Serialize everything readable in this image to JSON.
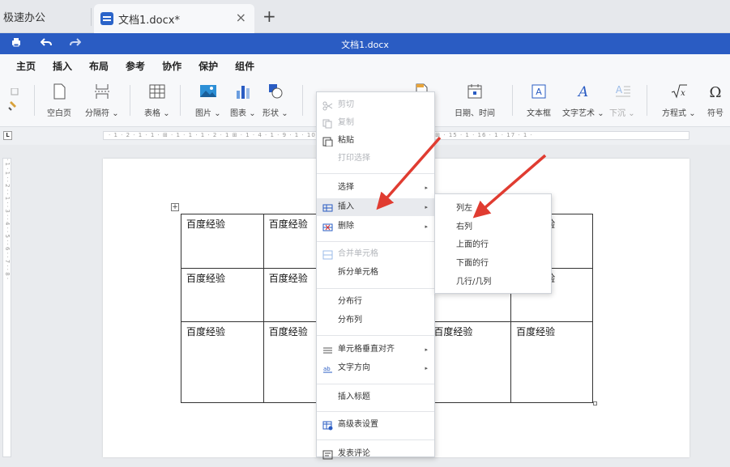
{
  "tabs": {
    "app_label": "极速办公",
    "doc_tab_label": "文档1.docx*",
    "close": "×",
    "new": "+"
  },
  "titlebar": {
    "doc_title": "文档1.docx",
    "icons": [
      "print-icon",
      "undo-icon",
      "redo-icon"
    ]
  },
  "menu_tabs": [
    "主页",
    "插入",
    "布局",
    "参考",
    "协作",
    "保护",
    "组件"
  ],
  "active_menu_tab": "插入",
  "ribbon": {
    "blank_page": "空白页",
    "page_break": "分隔符",
    "table": "表格",
    "picture": "图片",
    "chart": "图表",
    "shape": "形状",
    "header_footer_partial": "脚",
    "datetime": "日期、时间",
    "textbox": "文本框",
    "textart": "文字艺术",
    "dropcap": "下沉",
    "equation": "方程式",
    "symbol": "符号",
    "dropdown_mark": "⌄"
  },
  "ruler": {
    "marks": "· 1 · 2 · 1 · 1 · ⊞ · 1 · 1 · 1 · 2 · 1 ⊞ · 1 · 4 · 1 ·                                     9 · 1 · 10 · 1 · 11 · ⊞ 12 · 1 · 13 · 1 · 14 · ⊞ · 15 · 1 · 16 · 1 · 17 · 1 ·",
    "vertical_marks": "· 1 · 1 · · 2 · · 1 · · 3 · · 4 · · 5 · · 6 · · 7 · · 8 ·",
    "corner": "L"
  },
  "table": {
    "rows": [
      [
        "百度经验",
        "百度经验",
        "",
        "",
        "百度经验"
      ],
      [
        "百度经验",
        "百度经验",
        "",
        "",
        "百度经验"
      ],
      [
        "百度经验",
        "百度经验",
        "",
        "百度经验",
        "百度经验"
      ]
    ],
    "move_handle": "+"
  },
  "context_menu": {
    "items": [
      {
        "label": "剪切",
        "icon": "scissors-icon",
        "enabled": false
      },
      {
        "label": "复制",
        "icon": "copy-icon",
        "enabled": false
      },
      {
        "label": "粘贴",
        "icon": "paste-icon",
        "enabled": true
      },
      {
        "label": "打印选择",
        "icon": "",
        "enabled": false
      },
      {
        "label": "选择",
        "icon": "",
        "enabled": true,
        "submenu": true
      },
      {
        "label": "插入",
        "icon": "insert-icon",
        "enabled": true,
        "submenu": true,
        "highlighted": true
      },
      {
        "label": "删除",
        "icon": "delete-icon",
        "enabled": true,
        "submenu": true
      },
      {
        "label": "合并单元格",
        "icon": "merge-cells-icon",
        "enabled": false
      },
      {
        "label": "拆分单元格",
        "icon": "",
        "enabled": true
      },
      {
        "label": "分布行",
        "icon": "",
        "enabled": true
      },
      {
        "label": "分布列",
        "icon": "",
        "enabled": true
      },
      {
        "label": "单元格垂直对齐",
        "icon": "align-icon",
        "enabled": true,
        "submenu": true
      },
      {
        "label": "文字方向",
        "icon": "text-direction-icon",
        "enabled": true,
        "submenu": true
      },
      {
        "label": "插入标题",
        "icon": "",
        "enabled": true
      },
      {
        "label": "高级表设置",
        "icon": "table-settings-icon",
        "enabled": true
      },
      {
        "label": "发表评论",
        "icon": "comment-icon",
        "enabled": true
      }
    ],
    "submenu_arrow": "▸"
  },
  "insert_submenu": {
    "items": [
      "列左",
      "右列",
      "上面的行",
      "下面的行",
      "几行/几列"
    ]
  },
  "colors": {
    "accent": "#2a5cc3",
    "arrow": "#e03c31"
  }
}
